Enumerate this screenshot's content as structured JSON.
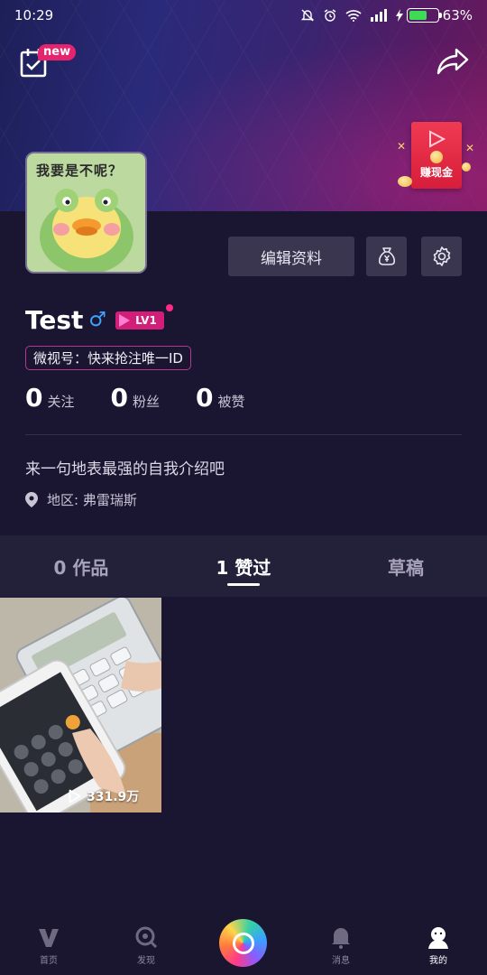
{
  "status_bar": {
    "time": "10:29",
    "battery_percent": "63%",
    "battery_level": 0.63
  },
  "header": {
    "new_badge": "new",
    "red_packet_label": "赚现金"
  },
  "avatar": {
    "caption": "我要是不呢？"
  },
  "actions": {
    "edit_profile": "编辑资料"
  },
  "profile": {
    "name": "Test",
    "gender_symbol": "♂",
    "level": "LV1",
    "weishi_id": "微视号：快来抢注唯一ID",
    "bio": "来一句地表最强的自我介绍吧",
    "region": "地区: 弗雷瑞斯"
  },
  "stats": [
    {
      "count": "0",
      "label": "关注"
    },
    {
      "count": "0",
      "label": "粉丝"
    },
    {
      "count": "0",
      "label": "被赞"
    }
  ],
  "tabs": [
    {
      "label": "0 作品",
      "active": false
    },
    {
      "label": "1 赞过",
      "active": true
    },
    {
      "label": "草稿",
      "active": false
    }
  ],
  "videos": [
    {
      "play_count": "331.9万"
    }
  ],
  "bottom_nav": [
    {
      "label": "首页",
      "icon": "weishi-logo-icon"
    },
    {
      "label": "发现",
      "icon": "discover-icon"
    },
    {
      "label": "",
      "icon": "camera-icon"
    },
    {
      "label": "消息",
      "icon": "bell-icon"
    },
    {
      "label": "我的",
      "icon": "profile-icon",
      "active": true
    }
  ],
  "colors": {
    "background": "#1a1530",
    "accent_pink": "#d21e78",
    "male_blue": "#3fa3ff",
    "battery_green": "#3ddc54"
  }
}
